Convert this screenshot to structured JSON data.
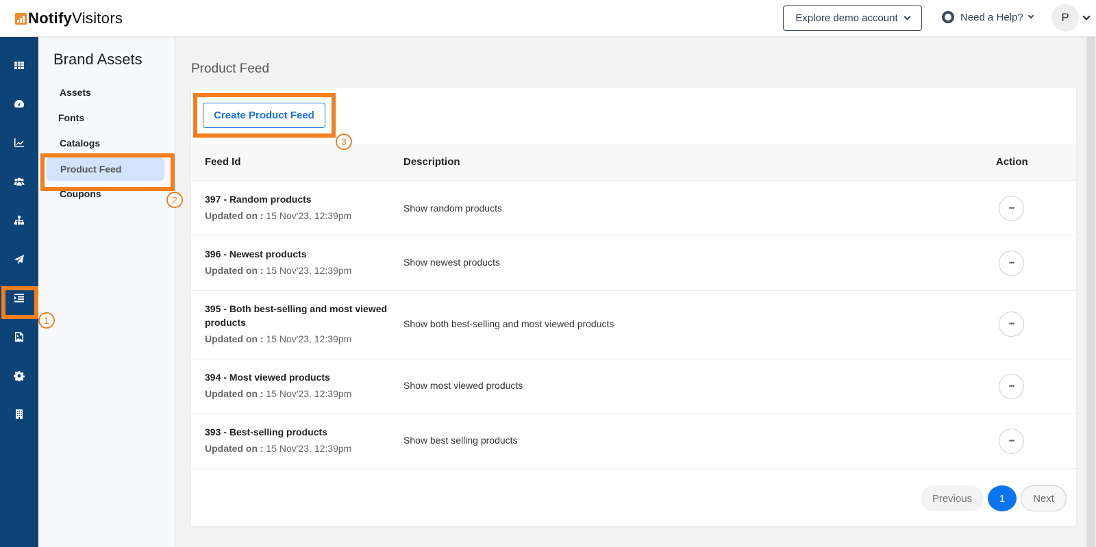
{
  "brand": {
    "name_bold": "Notify",
    "name_regular": "Visitors",
    "accent": "#f28a2e"
  },
  "header": {
    "explore_label": "Explore demo account",
    "help_label": "Need a Help?",
    "avatar_initial": "P"
  },
  "rail": {
    "items": [
      {
        "icon": "grid-icon",
        "label": "apps"
      },
      {
        "icon": "dashboard-gauge-icon",
        "label": "dashboard"
      },
      {
        "icon": "analytics-chart-icon",
        "label": "analytics"
      },
      {
        "icon": "users-icon",
        "label": "audience"
      },
      {
        "icon": "sitemap-icon",
        "label": "journeys"
      },
      {
        "icon": "paper-plane-icon",
        "label": "campaigns"
      },
      {
        "icon": "list-indent-icon",
        "label": "brand-assets",
        "active": true
      },
      {
        "icon": "image-file-icon",
        "label": "media"
      },
      {
        "icon": "gear-icon",
        "label": "settings"
      },
      {
        "icon": "building-icon",
        "label": "account"
      }
    ],
    "color": "#0d4478"
  },
  "subnav": {
    "title": "Brand Assets",
    "items": [
      {
        "label": "Assets"
      },
      {
        "label": "Fonts"
      },
      {
        "label": "Catalogs"
      },
      {
        "label": "Product Feed",
        "active": true
      },
      {
        "label": "Coupons"
      }
    ]
  },
  "main": {
    "title": "Product Feed",
    "create_label": "Create Product Feed",
    "columns": {
      "feed_id": "Feed Id",
      "description": "Description",
      "action": "Action"
    },
    "updated_label": "Updated on :",
    "rows": [
      {
        "id": "397",
        "name": "Random products",
        "updated": "15 Nov'23, 12:39pm",
        "description": "Show random products"
      },
      {
        "id": "396",
        "name": "Newest products",
        "updated": "15 Nov'23, 12:39pm",
        "description": "Show newest products"
      },
      {
        "id": "395",
        "name": "Both best-selling and most viewed products",
        "updated": "15 Nov'23, 12:39pm",
        "description": "Show both best-selling and most viewed products"
      },
      {
        "id": "394",
        "name": "Most viewed products",
        "updated": "15 Nov'23, 12:39pm",
        "description": "Show most viewed products"
      },
      {
        "id": "393",
        "name": "Best-selling products",
        "updated": "15 Nov'23, 12:39pm",
        "description": "Show best selling products"
      }
    ],
    "action_glyph": "•••",
    "pagination": {
      "previous": "Previous",
      "current": "1",
      "next": "Next"
    }
  },
  "annotations": [
    {
      "number": "1",
      "target": "rail brand-assets icon"
    },
    {
      "number": "2",
      "target": "Product Feed menu item"
    },
    {
      "number": "3",
      "target": "Create Product Feed button"
    }
  ],
  "highlight_color": "#f27e1e"
}
